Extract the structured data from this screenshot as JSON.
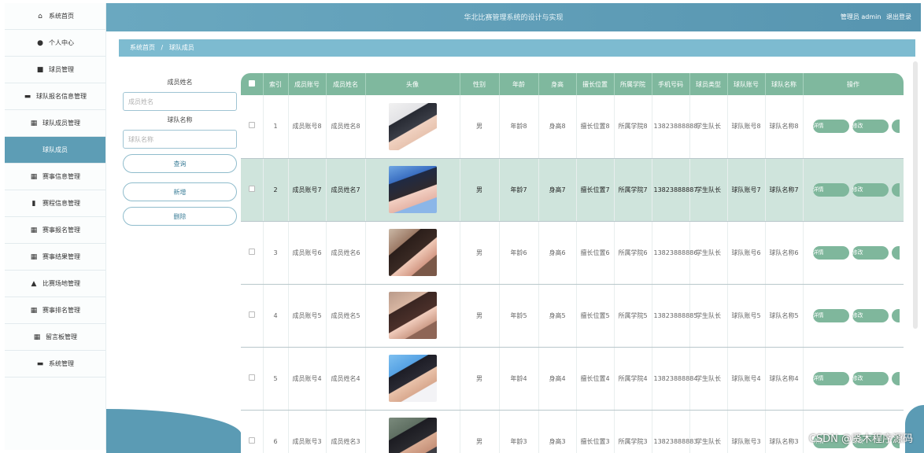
{
  "app": {
    "title": "华北比赛管理系统的设计与实现",
    "user_label": "管理员 admin",
    "logout_label": "退出登录"
  },
  "sidebar": {
    "items": [
      {
        "label": "系统首页",
        "icon": "home-icon",
        "glyph": "⌂",
        "active": false
      },
      {
        "label": "个人中心",
        "icon": "user-icon",
        "glyph": "●",
        "active": false
      },
      {
        "label": "球员管理",
        "icon": "player-icon",
        "glyph": "■",
        "active": false
      },
      {
        "label": "球队报名信息管理",
        "icon": "signup-icon",
        "glyph": "▬",
        "active": false
      },
      {
        "label": "球队成员管理",
        "icon": "grid-icon",
        "glyph": "▦",
        "active": false
      },
      {
        "label": "球队成员",
        "icon": "",
        "glyph": "",
        "active": true
      },
      {
        "label": "赛事信息管理",
        "icon": "grid-icon",
        "glyph": "▦",
        "active": false
      },
      {
        "label": "赛程信息管理",
        "icon": "chart-icon",
        "glyph": "▮",
        "active": false
      },
      {
        "label": "赛事报名管理",
        "icon": "grid-icon",
        "glyph": "▦",
        "active": false
      },
      {
        "label": "赛事结果管理",
        "icon": "grid-icon",
        "glyph": "▦",
        "active": false
      },
      {
        "label": "比赛场地管理",
        "icon": "thumb-icon",
        "glyph": "▲",
        "active": false
      },
      {
        "label": "赛事排名管理",
        "icon": "grid-icon",
        "glyph": "▦",
        "active": false
      },
      {
        "label": "留言板管理",
        "icon": "grid-icon",
        "glyph": "▦",
        "active": false
      },
      {
        "label": "系统管理",
        "icon": "system-icon",
        "glyph": "▬",
        "active": false
      }
    ]
  },
  "breadcrumb": {
    "home": "系统首页",
    "separator": "/",
    "current": "球队成员"
  },
  "search": {
    "member_name_label": "成员姓名",
    "member_name_placeholder": "成员姓名",
    "team_name_label": "球队名称",
    "team_name_placeholder": "球队名称",
    "query_button": "查询",
    "add_button": "新增",
    "delete_button": "删除"
  },
  "table": {
    "columns": [
      "索引",
      "成员账号",
      "成员姓名",
      "头像",
      "性别",
      "年龄",
      "身高",
      "擅长位置",
      "所属学院",
      "手机号码",
      "球员类型",
      "球队账号",
      "球队名称",
      "操作"
    ],
    "detail_label": "详情",
    "edit_label": "修改",
    "rows": [
      {
        "index": "1",
        "account": "成员账号8",
        "name": "成员姓名8",
        "gender": "男",
        "age": "年龄8",
        "height": "身高8",
        "position": "擅长位置8",
        "college": "所属学院8",
        "phone": "13823888888",
        "type": "学生队长",
        "team_account": "球队账号8",
        "team_name": "球队名称8",
        "photo": "p1"
      },
      {
        "index": "2",
        "account": "成员账号7",
        "name": "成员姓名7",
        "gender": "男",
        "age": "年龄7",
        "height": "身高7",
        "position": "擅长位置7",
        "college": "所属学院7",
        "phone": "13823888887",
        "type": "学生队长",
        "team_account": "球队账号7",
        "team_name": "球队名称7",
        "photo": "p2"
      },
      {
        "index": "3",
        "account": "成员账号6",
        "name": "成员姓名6",
        "gender": "男",
        "age": "年龄6",
        "height": "身高6",
        "position": "擅长位置6",
        "college": "所属学院6",
        "phone": "13823888886",
        "type": "学生队长",
        "team_account": "球队账号6",
        "team_name": "球队名称6",
        "photo": "p3"
      },
      {
        "index": "4",
        "account": "成员账号5",
        "name": "成员姓名5",
        "gender": "男",
        "age": "年龄5",
        "height": "身高5",
        "position": "擅长位置5",
        "college": "所属学院5",
        "phone": "13823888885",
        "type": "学生队长",
        "team_account": "球队账号5",
        "team_name": "球队名称5",
        "photo": "p4"
      },
      {
        "index": "5",
        "account": "成员账号4",
        "name": "成员姓名4",
        "gender": "男",
        "age": "年龄4",
        "height": "身高4",
        "position": "擅长位置4",
        "college": "所属学院4",
        "phone": "13823888884",
        "type": "学生队长",
        "team_account": "球队账号4",
        "team_name": "球队名称4",
        "photo": "p5"
      },
      {
        "index": "6",
        "account": "成员账号3",
        "name": "成员姓名3",
        "gender": "男",
        "age": "年龄3",
        "height": "身高3",
        "position": "擅长位置3",
        "college": "所属学院3",
        "phone": "13823888883",
        "type": "学生队长",
        "team_account": "球队账号3",
        "team_name": "球队名称3",
        "photo": "p6"
      }
    ]
  },
  "highlight_row_index": 1,
  "watermark": "CSDN @贤木程序源码",
  "colors": {
    "header_bg": "#5d9db5",
    "table_header_bg": "#7fb89e",
    "action_button": "#7fb79c",
    "highlight_row": "#cfe4dc"
  }
}
